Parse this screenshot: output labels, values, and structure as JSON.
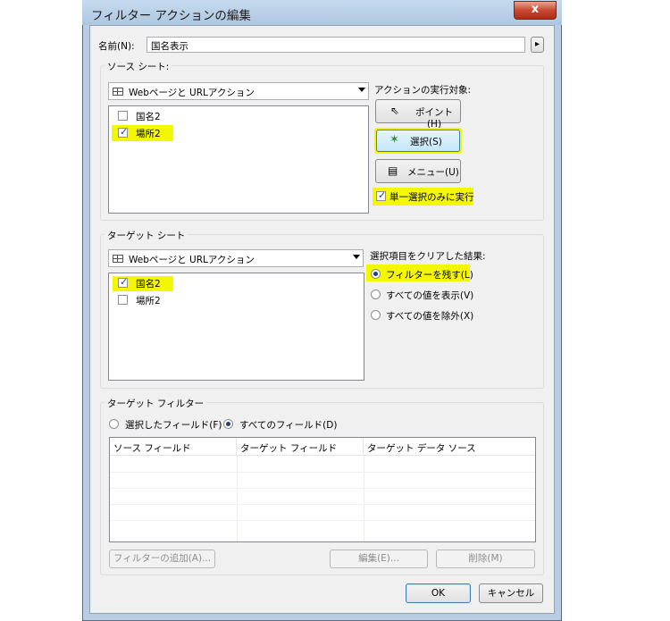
{
  "window": {
    "title": "フィルター アクションの編集",
    "close_glyph": "x"
  },
  "name_field": {
    "label": "名前(N):",
    "value": "国名表示",
    "menu_glyph": "▸"
  },
  "source_sheets": {
    "group_title": "ソース シート:",
    "combo_value": "Webページと URLアクション",
    "items": [
      {
        "label": "国名2",
        "checked": false
      },
      {
        "label": "場所2",
        "checked": true
      }
    ],
    "run_on_label": "アクションの実行対象:",
    "buttons": {
      "hover": "ポイント(H)",
      "select": "選択(S)",
      "menu": "メニュー(U)"
    },
    "single_select_label": "単一選択のみに実行"
  },
  "target_sheets": {
    "group_title": "ターゲット シート",
    "combo_value": "Webページと URLアクション",
    "items": [
      {
        "label": "国名2",
        "checked": true
      },
      {
        "label": "場所2",
        "checked": false
      }
    ],
    "clear_label": "選択項目をクリアした結果:",
    "options": [
      "フィルターを残す(L)",
      "すべての値を表示(V)",
      "すべての値を除外(X)"
    ],
    "selected_option": 0
  },
  "target_filters": {
    "group_title": "ターゲット フィルター",
    "radio_selected_fields": "選択したフィールド(F)",
    "radio_all_fields": "すべてのフィールド(D)",
    "selected_radio": "all_fields",
    "columns": [
      "ソース フィールド",
      "ターゲット フィールド",
      "ターゲット データ ソース"
    ],
    "add_filter": "フィルターの追加(A)...",
    "edit": "編集(E)...",
    "remove": "削除(M)"
  },
  "footer": {
    "ok": "OK",
    "cancel": "キャンセル"
  },
  "colors": {
    "highlight": "#f3f800",
    "frame": "#b8cde2",
    "close": "#c8482f"
  }
}
